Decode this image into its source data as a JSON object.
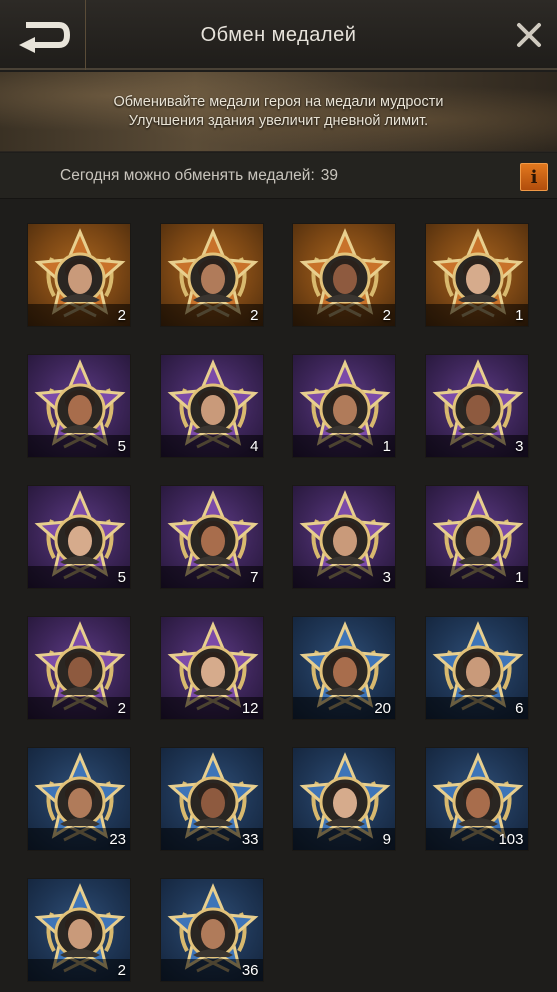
{
  "header": {
    "title": "Обмен медалей",
    "back_icon": "back-arrow-icon",
    "close_icon": "close-icon"
  },
  "banner": {
    "line1": "Обменивайте медали героя на медали мудрости",
    "line2": "Улучшения здания увеличит дневной лимит."
  },
  "limit": {
    "label": "Сегодня можно обменять медалей:",
    "value": "39"
  },
  "info_button": {
    "label": "i"
  },
  "colors": {
    "orange": "#a9651f",
    "purple": "#5d3b86",
    "blue": "#2f4f78",
    "gold": "#e2c27a",
    "info": "#e2781e"
  },
  "medals": [
    {
      "rarity": "orange",
      "count": "2",
      "icon": "hero-portrait-icon"
    },
    {
      "rarity": "orange",
      "count": "2",
      "icon": "hero-portrait-icon"
    },
    {
      "rarity": "orange",
      "count": "2",
      "icon": "hero-portrait-icon"
    },
    {
      "rarity": "orange",
      "count": "1",
      "icon": "hero-portrait-icon"
    },
    {
      "rarity": "purple",
      "count": "5",
      "icon": "hero-portrait-icon"
    },
    {
      "rarity": "purple",
      "count": "4",
      "icon": "hero-portrait-icon"
    },
    {
      "rarity": "purple",
      "count": "1",
      "icon": "hero-portrait-icon"
    },
    {
      "rarity": "purple",
      "count": "3",
      "icon": "hero-portrait-icon"
    },
    {
      "rarity": "purple",
      "count": "5",
      "icon": "hero-portrait-icon"
    },
    {
      "rarity": "purple",
      "count": "7",
      "icon": "hero-portrait-icon"
    },
    {
      "rarity": "purple",
      "count": "3",
      "icon": "hero-portrait-icon"
    },
    {
      "rarity": "purple",
      "count": "1",
      "icon": "hero-portrait-icon"
    },
    {
      "rarity": "purple",
      "count": "2",
      "icon": "hero-portrait-icon"
    },
    {
      "rarity": "purple",
      "count": "12",
      "icon": "hero-portrait-icon"
    },
    {
      "rarity": "blue",
      "count": "20",
      "icon": "hero-portrait-icon"
    },
    {
      "rarity": "blue",
      "count": "6",
      "icon": "hero-portrait-icon"
    },
    {
      "rarity": "blue",
      "count": "23",
      "icon": "hero-portrait-icon"
    },
    {
      "rarity": "blue",
      "count": "33",
      "icon": "hero-portrait-icon"
    },
    {
      "rarity": "blue",
      "count": "9",
      "icon": "hero-portrait-icon"
    },
    {
      "rarity": "blue",
      "count": "103",
      "icon": "hero-portrait-icon"
    },
    {
      "rarity": "blue",
      "count": "2",
      "icon": "hero-portrait-icon"
    },
    {
      "rarity": "blue",
      "count": "36",
      "icon": "hero-portrait-icon"
    }
  ]
}
